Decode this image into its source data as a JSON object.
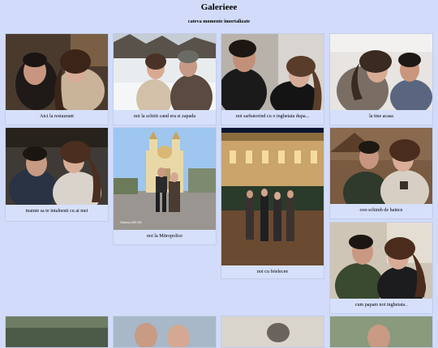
{
  "header": {
    "title": "Galerieee",
    "subtitle": "cateva momente imortalizate"
  },
  "gallery": {
    "items": [
      {
        "caption": "Aici la restaurant"
      },
      {
        "caption": "noi la schiiit cand era si zapada"
      },
      {
        "caption": "noi sarbatorind cu o inghetata dupa..."
      },
      {
        "caption": "la tine acasa"
      },
      {
        "caption": "inainte sa te intalnesti cu ai mei"
      },
      {
        "caption": "noi la Mitropolice"
      },
      {
        "caption": "noi cu fetelecee"
      },
      {
        "caption": "ooo schimb de haince"
      },
      {
        "caption": "cum papam noi inghetata.."
      },
      {
        "caption": ""
      },
      {
        "caption": ""
      },
      {
        "caption": ""
      },
      {
        "caption": ""
      }
    ],
    "photo_watermark": "Galaxy A55 5G"
  }
}
